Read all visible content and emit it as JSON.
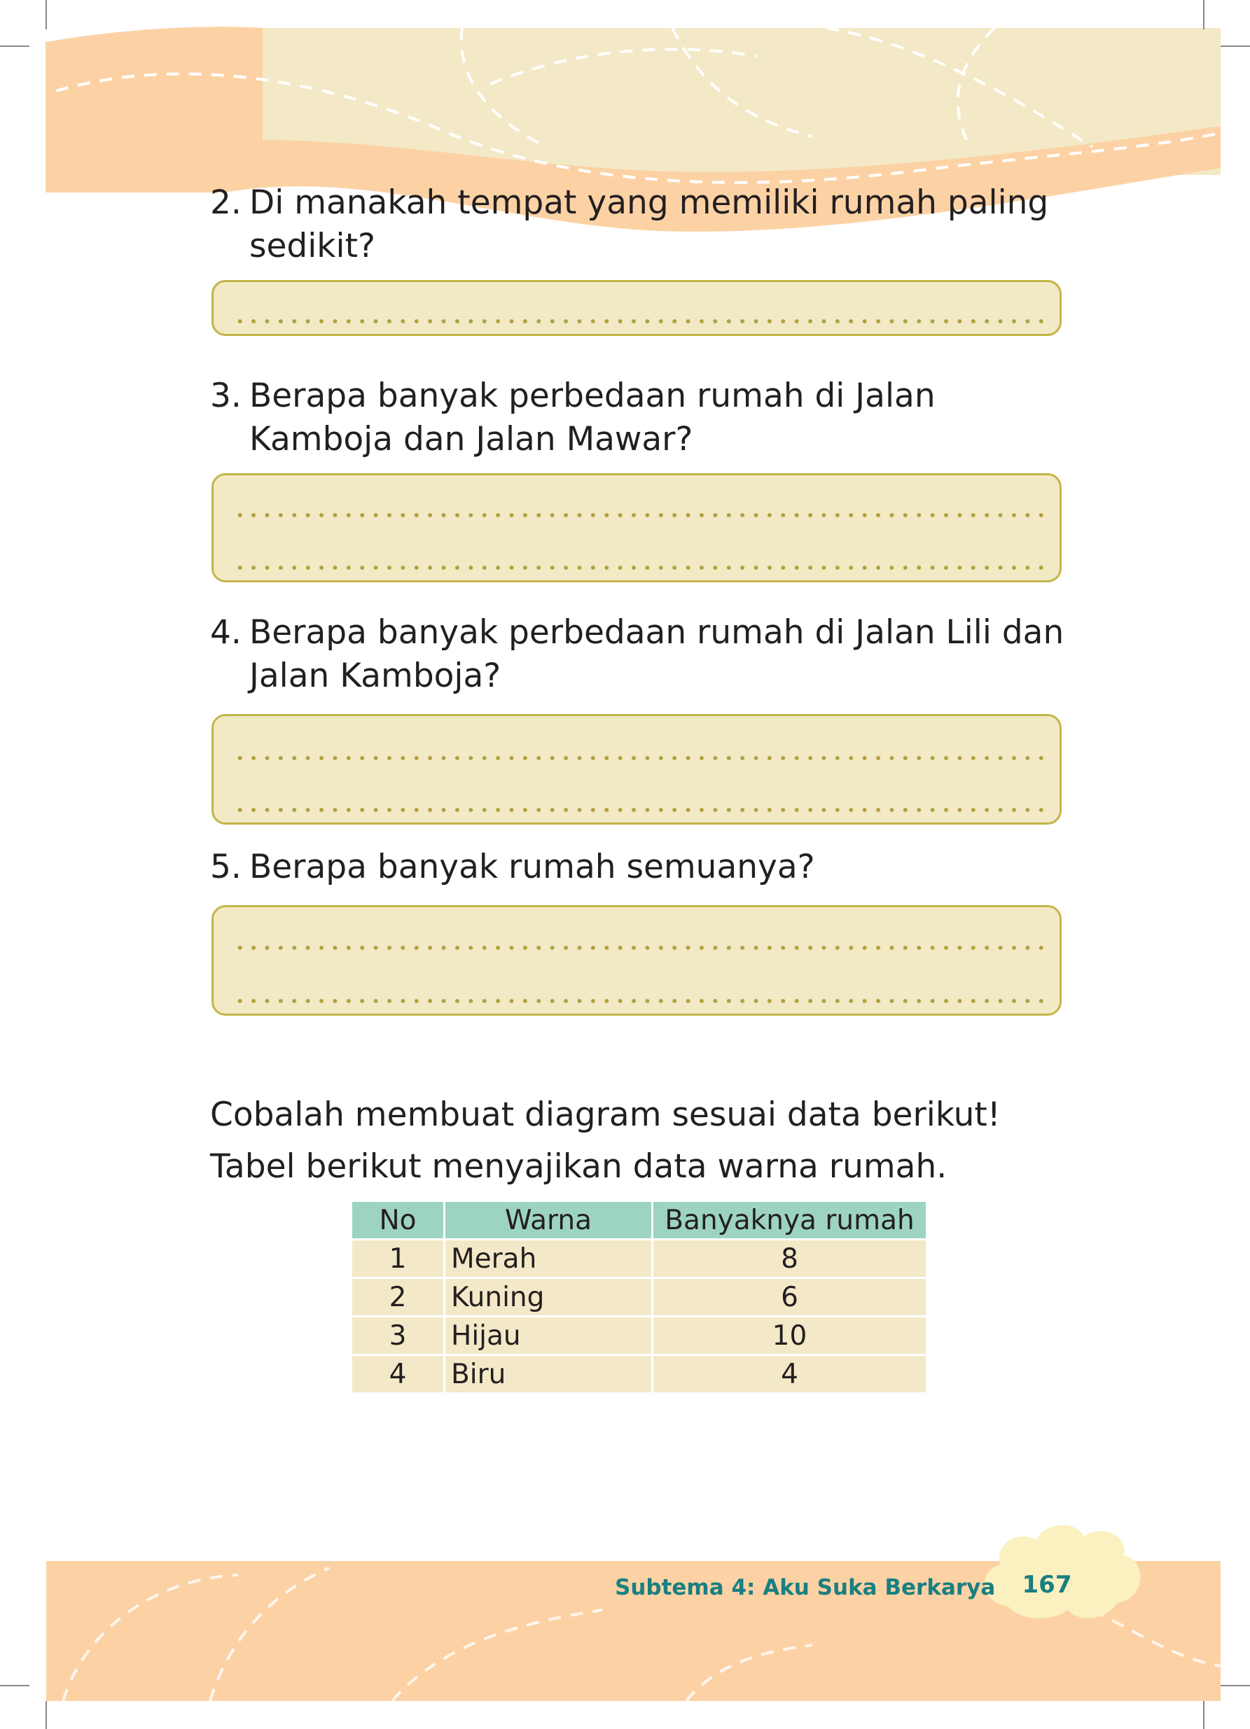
{
  "questions": [
    {
      "num": "2.",
      "text": "Di manakah tempat yang memiliki rumah paling sedikit?"
    },
    {
      "num": "3.",
      "text": "Berapa banyak perbedaan rumah di Jalan Kamboja dan Jalan Mawar?"
    },
    {
      "num": "4.",
      "text": "Berapa banyak perbedaan rumah di Jalan Lili dan Jalan Kamboja?"
    },
    {
      "num": "5.",
      "text": "Berapa banyak rumah semuanya?"
    }
  ],
  "instruction": "Cobalah membuat diagram sesuai data berikut!",
  "table_intro": "Tabel berikut menyajikan data warna rumah.",
  "table": {
    "headers": [
      "No",
      "Warna",
      "Banyaknya rumah"
    ],
    "rows": [
      [
        "1",
        "Merah",
        "8"
      ],
      [
        "2",
        "Kuning",
        "6"
      ],
      [
        "3",
        "Hijau",
        "10"
      ],
      [
        "4",
        "Biru",
        "4"
      ]
    ]
  },
  "footer": {
    "subtitle": "Subtema 4: Aku Suka Berkarya",
    "page_number": "167"
  },
  "colors": {
    "header_cream": "#f3e9c6",
    "header_peach": "#fcd2a5",
    "answer_box_fill": "#f2e9c5",
    "answer_box_border": "#c3b54a",
    "table_header": "#9dd4c0",
    "table_cell": "#f3e9c8",
    "footer_text": "#1a7f80"
  }
}
